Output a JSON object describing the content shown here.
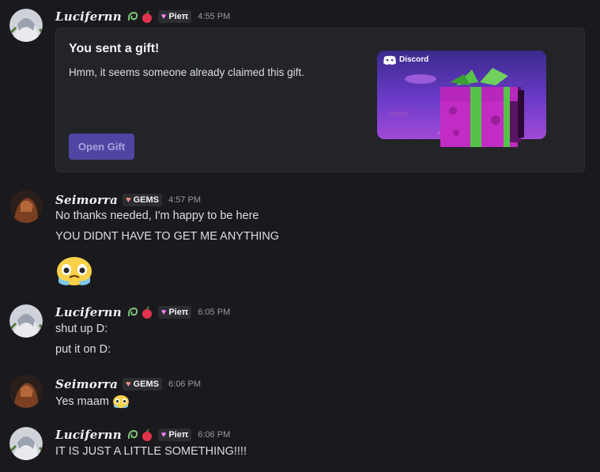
{
  "messages": [
    {
      "author": "Lucifernn",
      "tag": "Pieπ",
      "time": "4:55 PM"
    },
    {
      "author": "Seimorra",
      "tag": "GEMS",
      "time": "4:57 PM",
      "lines": [
        "No thanks needed, I'm happy to be here",
        "YOU DIDNT HAVE TO GET ME ANYTHING"
      ]
    },
    {
      "author": "Lucifernn",
      "tag": "Pieπ",
      "time": "6:05 PM",
      "lines": [
        "shut up D:",
        "put it on D:"
      ]
    },
    {
      "author": "Seimorra",
      "tag": "GEMS",
      "time": "6:06 PM",
      "lines": [
        "Yes maam"
      ]
    },
    {
      "author": "Lucifernn",
      "tag": "Pieπ",
      "time": "6:06 PM",
      "lines": [
        "IT IS JUST A LITTLE SOMETHING!!!!"
      ]
    }
  ],
  "gift": {
    "title": "You sent a gift!",
    "description": "Hmm, it seems someone already claimed this gift.",
    "button": "Open Gift",
    "brand": "Discord"
  },
  "icons": {
    "user_deco_1": "swirl-leaf-icon",
    "user_deco_2": "apple-icon",
    "tag_icon": "heart-icon",
    "emoji": "crying-face-emoji"
  },
  "colors": {
    "background": "#1a1a1e",
    "gift_button": "#4f46a3",
    "gift_art_top": "#3a2a8c",
    "gift_art_bottom": "#a04ad6",
    "gift_box": "#c22bc4",
    "gift_ribbon": "#57c24a"
  }
}
